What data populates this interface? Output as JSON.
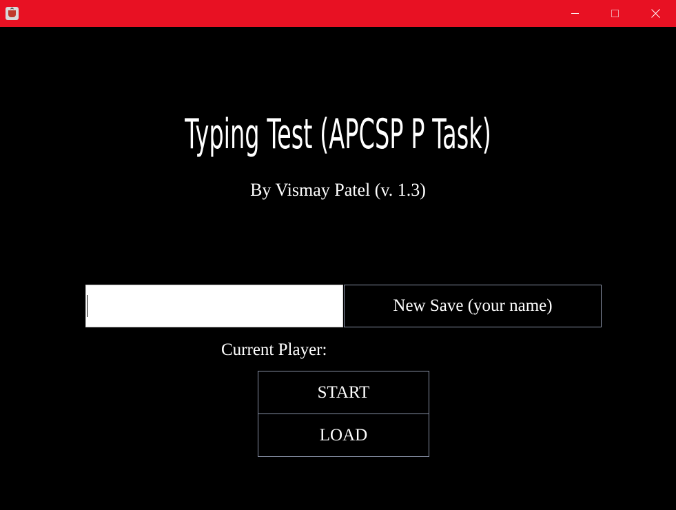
{
  "window": {
    "titlebar_color": "#e81123",
    "app_icon": "java-cup-icon",
    "controls": {
      "minimize_icon": "minimize-icon",
      "maximize_icon": "maximize-icon",
      "close_icon": "close-icon"
    }
  },
  "main": {
    "title": "Typing Test (APCSP P Task)",
    "subtitle": "By Vismay Patel (v. 1.3)",
    "name_input": {
      "value": "",
      "placeholder": ""
    },
    "new_save_label": "New Save (your name)",
    "current_player_label": "Current Player:",
    "start_label": "START",
    "load_label": "LOAD"
  },
  "colors": {
    "background": "#000000",
    "text": "#ffffff",
    "button_border": "#8a93a8"
  }
}
